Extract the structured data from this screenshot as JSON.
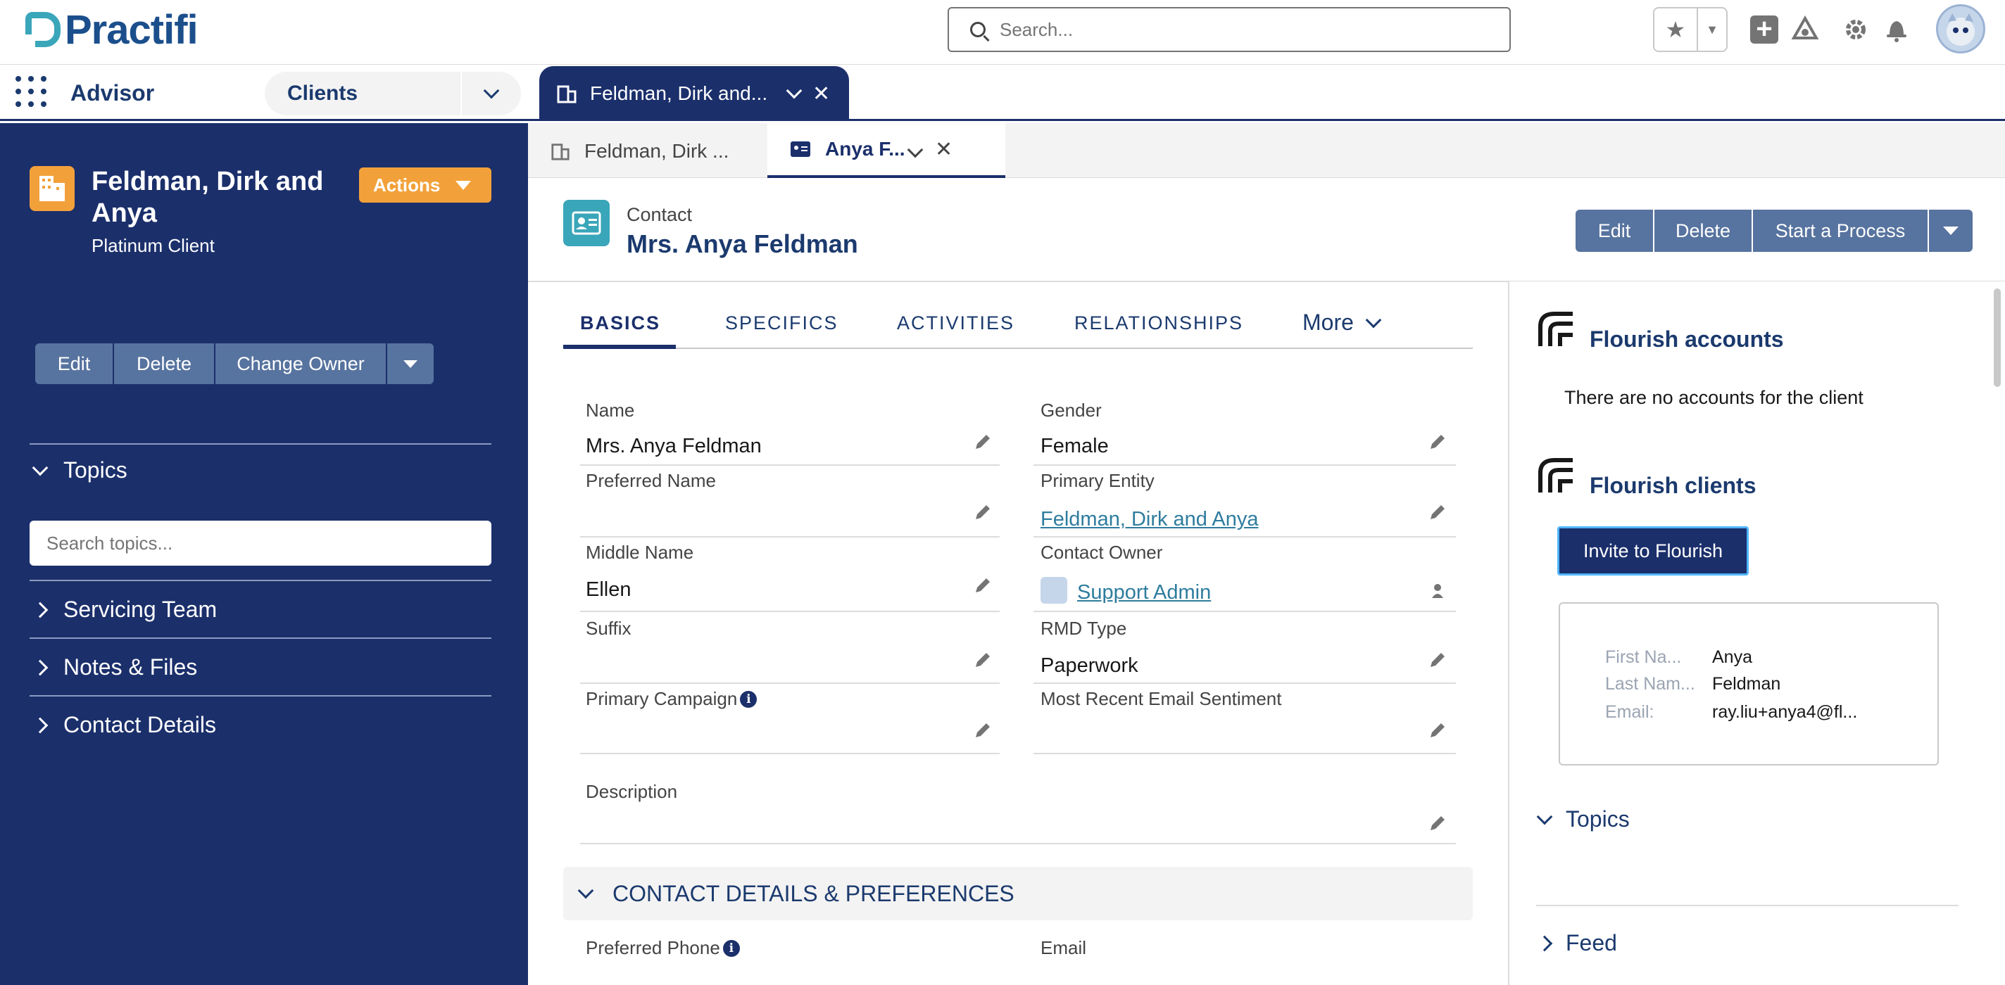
{
  "header": {
    "logo_text": "Practifi",
    "search_placeholder": "Search..."
  },
  "nav": {
    "app_name": "Advisor",
    "object_select": "Clients",
    "workspace_tab_title": "Feldman, Dirk and..."
  },
  "subtabs": [
    {
      "label": "Feldman, Dirk ..."
    },
    {
      "label": "Anya F..."
    }
  ],
  "sidebar": {
    "account_name": "Feldman, Dirk and Anya",
    "account_type": "Platinum Client",
    "actions_label": "Actions",
    "buttons": [
      "Edit",
      "Delete",
      "Change Owner"
    ],
    "sections": {
      "topics": "Topics",
      "servicing_team": "Servicing Team",
      "notes_files": "Notes & Files",
      "contact_details": "Contact Details"
    },
    "topics_search_placeholder": "Search topics..."
  },
  "record": {
    "object_label": "Contact",
    "title": "Mrs. Anya Feldman",
    "buttons": [
      "Edit",
      "Delete",
      "Start a Process"
    ]
  },
  "tabs": [
    "BASICS",
    "SPECIFICS",
    "ACTIVITIES",
    "RELATIONSHIPS"
  ],
  "tab_more": "More",
  "fields": {
    "name": {
      "label": "Name",
      "value": "Mrs. Anya Feldman"
    },
    "gender": {
      "label": "Gender",
      "value": "Female"
    },
    "preferred_name": {
      "label": "Preferred Name",
      "value": ""
    },
    "primary_entity": {
      "label": "Primary Entity",
      "value": "Feldman, Dirk and Anya"
    },
    "middle_name": {
      "label": "Middle Name",
      "value": "Ellen"
    },
    "contact_owner": {
      "label": "Contact Owner",
      "value": "Support Admin"
    },
    "suffix": {
      "label": "Suffix",
      "value": ""
    },
    "rmd_type": {
      "label": "RMD Type",
      "value": "Paperwork"
    },
    "primary_campaign": {
      "label": "Primary Campaign",
      "value": ""
    },
    "email_sentiment": {
      "label": "Most Recent Email Sentiment",
      "value": ""
    },
    "description": {
      "label": "Description",
      "value": ""
    }
  },
  "section": {
    "title": "CONTACT DETAILS & PREFERENCES",
    "preferred_phone_label": "Preferred Phone",
    "email_label": "Email"
  },
  "right_panel": {
    "accounts_title": "Flourish accounts",
    "no_accounts": "There are no accounts for the client",
    "clients_title": "Flourish clients",
    "invite_label": "Invite to Flourish",
    "card": [
      {
        "label": "First Na...",
        "value": "Anya"
      },
      {
        "label": "Last Nam...",
        "value": "Feldman"
      },
      {
        "label": "Email:",
        "value": "ray.liu+anya4@fl..."
      }
    ],
    "topics_label": "Topics",
    "feed_label": "Feed"
  },
  "colors": {
    "brand_navy": "#1b2f6b",
    "accent_orange": "#f2a13a",
    "teal": "#3aa6b9",
    "button_slate": "#57739f"
  }
}
